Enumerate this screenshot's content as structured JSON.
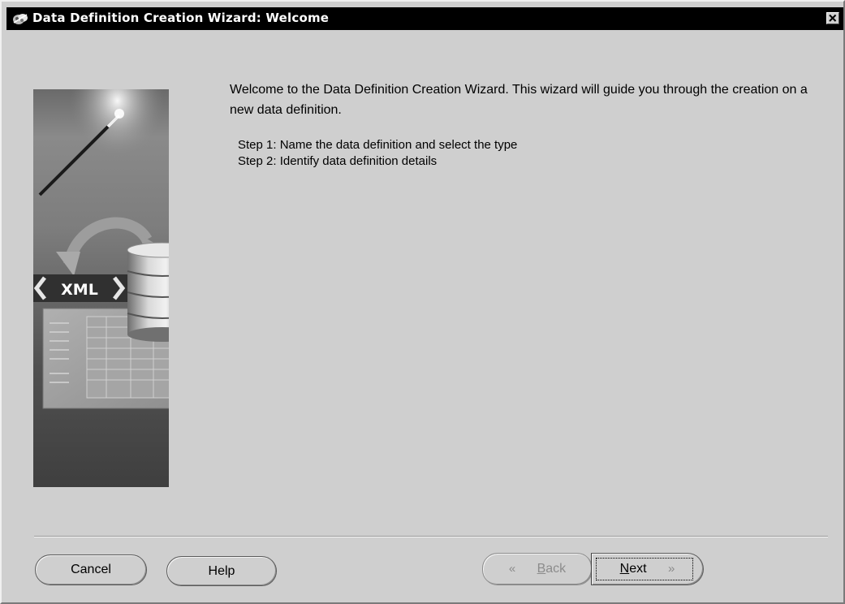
{
  "window": {
    "title": "Data Definition Creation Wizard: Welcome"
  },
  "icons": {
    "title": "wizard-app-icon",
    "close": "close-icon",
    "illustration": "xml-database-wizard-illustration"
  },
  "illustration": {
    "xml_label": "XML"
  },
  "content": {
    "welcome": "Welcome to the Data Definition Creation Wizard.  This wizard will guide you through the creation on a new data definition.",
    "steps": [
      "Step 1: Name the data definition and select the type",
      "Step 2: Identify data definition details"
    ]
  },
  "buttons": {
    "cancel": "Cancel",
    "help": "Help",
    "back": {
      "mnemonic": "B",
      "rest": "ack",
      "enabled": false
    },
    "next": {
      "mnemonic": "N",
      "rest": "ext",
      "enabled": true,
      "focused": true
    }
  },
  "colors": {
    "titlebar": "#000000",
    "dialog_background": "#cfcfcf",
    "disabled_text": "#8c8c8c"
  }
}
